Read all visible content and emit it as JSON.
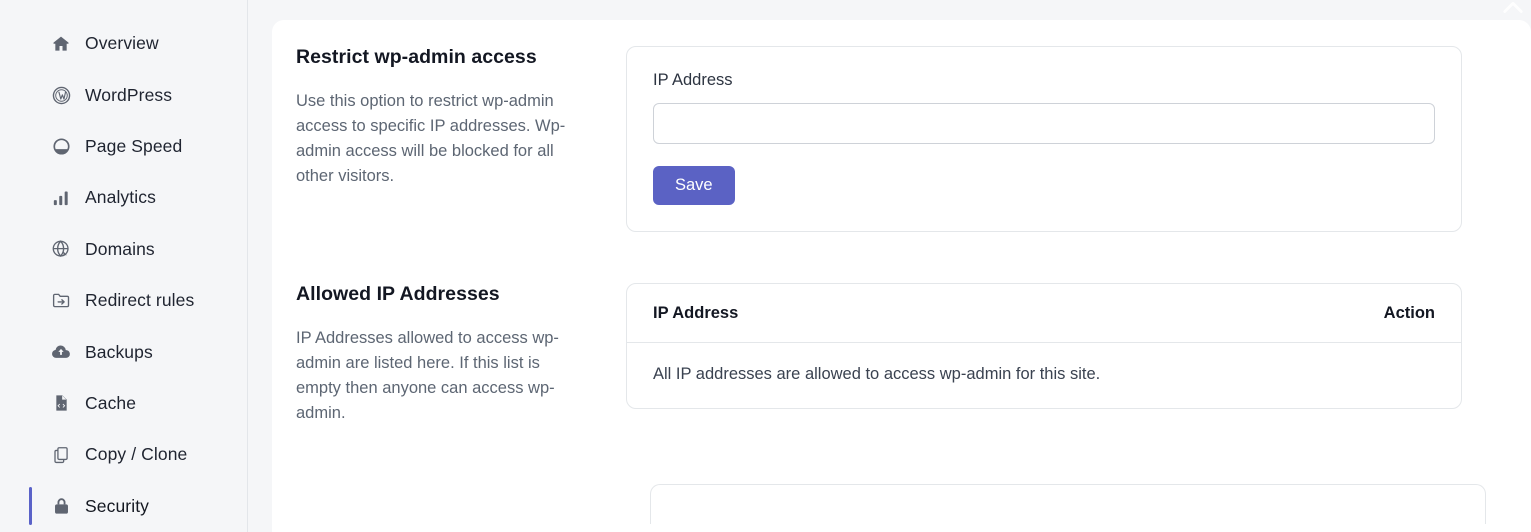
{
  "sidebar": {
    "items": [
      {
        "label": "Overview",
        "icon": "home-icon",
        "active": false
      },
      {
        "label": "WordPress",
        "icon": "wordpress-icon",
        "active": false
      },
      {
        "label": "Page Speed",
        "icon": "gauge-icon",
        "active": false
      },
      {
        "label": "Analytics",
        "icon": "bar-chart-icon",
        "active": false
      },
      {
        "label": "Domains",
        "icon": "globe-icon",
        "active": false
      },
      {
        "label": "Redirect rules",
        "icon": "folder-arrow-icon",
        "active": false
      },
      {
        "label": "Backups",
        "icon": "cloud-upload-icon",
        "active": false
      },
      {
        "label": "Cache",
        "icon": "file-code-icon",
        "active": false
      },
      {
        "label": "Copy / Clone",
        "icon": "copy-icon",
        "active": false
      },
      {
        "label": "Security",
        "icon": "lock-icon",
        "active": true
      }
    ]
  },
  "main": {
    "restrict_section": {
      "title": "Restrict wp-admin access",
      "description": "Use this option to restrict wp-admin access to specific IP addresses. Wp-admin access will be blocked for all other visitors.",
      "form": {
        "ip_label": "IP Address",
        "ip_value": "",
        "ip_placeholder": "",
        "save_label": "Save"
      }
    },
    "allowed_section": {
      "title": "Allowed IP Addresses",
      "description": "IP Addresses allowed to access wp-admin are listed here. If this list is empty then anyone can access wp-admin.",
      "table": {
        "columns": [
          "IP Address",
          "Action"
        ],
        "rows": [],
        "empty_message": "All IP addresses are allowed to access wp-admin for this site."
      }
    }
  },
  "colors": {
    "accent": "#5b62c4",
    "active_indicator": "#5a62c8",
    "sidebar_bg": "#f5f6f8",
    "card_border": "#e4e7ea",
    "input_border": "#ced2d8",
    "text_primary": "#131722",
    "text_muted": "#5d6673"
  }
}
